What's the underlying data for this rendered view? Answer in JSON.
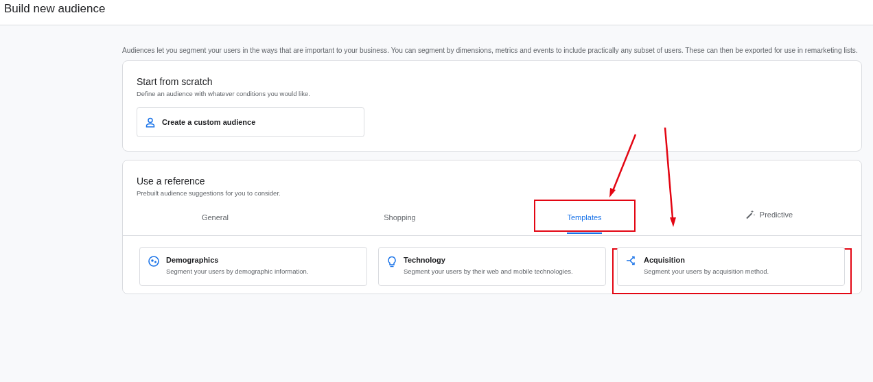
{
  "page_title": "Build new audience",
  "intro": "Audiences let you segment your users in the ways that are important to your business. You can segment by dimensions, metrics and events to include practically any subset of users. These can then be exported for use in remarketing lists.",
  "scratch": {
    "title": "Start from scratch",
    "subtitle": "Define an audience with whatever conditions you would like.",
    "button": "Create a custom audience"
  },
  "reference": {
    "title": "Use a reference",
    "subtitle": "Prebuilt audience suggestions for you to consider.",
    "tabs": [
      {
        "label": "General",
        "selected": false,
        "highlighted": false,
        "kind": "plain"
      },
      {
        "label": "Shopping",
        "selected": false,
        "highlighted": false,
        "kind": "plain"
      },
      {
        "label": "Templates",
        "selected": true,
        "highlighted": true,
        "kind": "plain"
      },
      {
        "label": "Predictive",
        "selected": false,
        "highlighted": false,
        "kind": "wand"
      }
    ],
    "cards": [
      {
        "kind": "demographics",
        "title": "Demographics",
        "description": "Segment your users by demographic information.",
        "highlighted": false
      },
      {
        "kind": "technology",
        "title": "Technology",
        "description": "Segment your users by their web and mobile technologies.",
        "highlighted": false
      },
      {
        "kind": "acquisition",
        "title": "Acquisition",
        "description": "Segment your users by acquisition method.",
        "highlighted": true
      }
    ]
  }
}
